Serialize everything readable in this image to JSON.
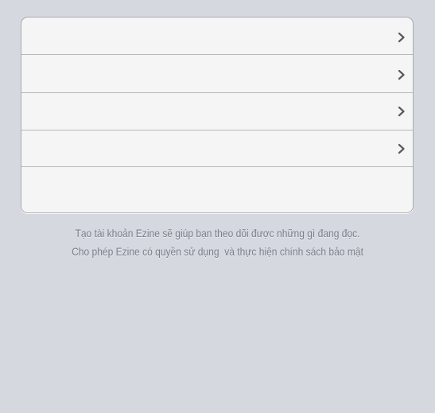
{
  "settings_group": {
    "rows": [
      {
        "label": "",
        "icon": "chevron-right-icon"
      },
      {
        "label": "",
        "icon": "chevron-right-icon"
      },
      {
        "label": "",
        "icon": "chevron-right-icon"
      },
      {
        "label": "",
        "icon": "chevron-right-icon"
      },
      {
        "label": ""
      }
    ]
  },
  "footer": {
    "line1": "Tạo tài khoản Ezine sẽ giúp bạn theo dõi được những gì đang đọc.",
    "line2": "Cho phép Ezine có quyền sử dụng  và thực hiện chính sách bảo mật"
  },
  "colors": {
    "background": "#d6d8e0",
    "cell_background": "#f5f5f5",
    "footer_text": "#7b7e88",
    "chevron": "#5a5a5a"
  }
}
